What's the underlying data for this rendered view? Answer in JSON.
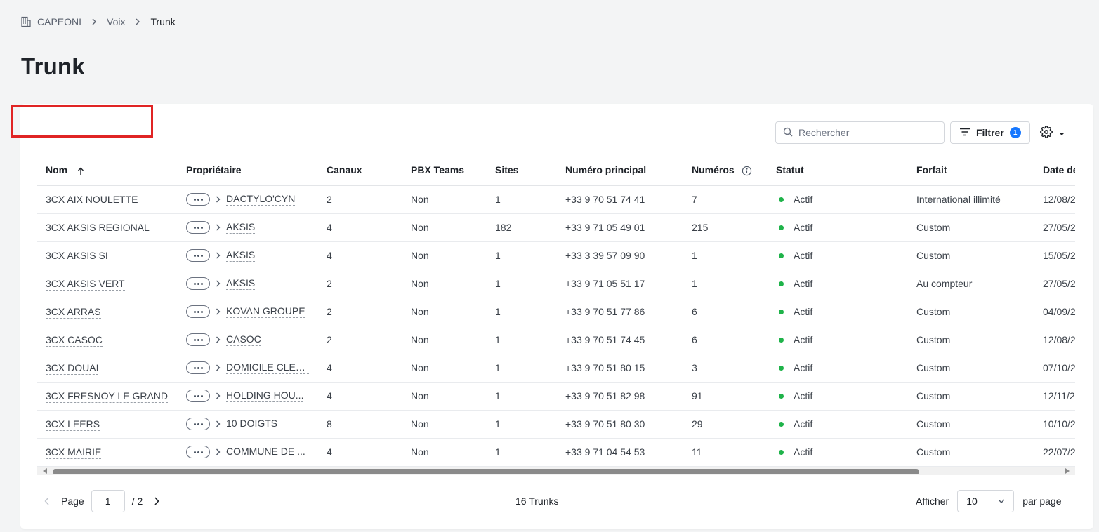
{
  "breadcrumb": {
    "org": "CAPEONI",
    "section": "Voix",
    "current": "Trunk"
  },
  "page_title": "Trunk",
  "search": {
    "placeholder": "Rechercher"
  },
  "filter": {
    "label": "Filtrer",
    "count": "1"
  },
  "columns": {
    "nom": "Nom",
    "proprietaire": "Propriétaire",
    "canaux": "Canaux",
    "pbx": "PBX Teams",
    "sites": "Sites",
    "numero": "Numéro principal",
    "numeros": "Numéros",
    "statut": "Statut",
    "forfait": "Forfait",
    "date": "Date de"
  },
  "rows": [
    {
      "nom": "3CX AIX NOULETTE",
      "owner": "DACTYLO'CYN",
      "canaux": "2",
      "pbx": "Non",
      "sites": "1",
      "numero": "+33 9 70 51 74 41",
      "numeros": "7",
      "statut": "Actif",
      "forfait": "International illimité",
      "date": "12/08/2"
    },
    {
      "nom": "3CX AKSIS REGIONAL",
      "owner": "AKSIS",
      "canaux": "4",
      "pbx": "Non",
      "sites": "182",
      "numero": "+33 9 71 05 49 01",
      "numeros": "215",
      "statut": "Actif",
      "forfait": "Custom",
      "date": "27/05/2"
    },
    {
      "nom": "3CX AKSIS SI",
      "owner": "AKSIS",
      "canaux": "4",
      "pbx": "Non",
      "sites": "1",
      "numero": "+33 3 39 57 09 90",
      "numeros": "1",
      "statut": "Actif",
      "forfait": "Custom",
      "date": "15/05/2"
    },
    {
      "nom": "3CX AKSIS VERT",
      "owner": "AKSIS",
      "canaux": "2",
      "pbx": "Non",
      "sites": "1",
      "numero": "+33 9 71 05 51 17",
      "numeros": "1",
      "statut": "Actif",
      "forfait": "Au compteur",
      "date": "27/05/2"
    },
    {
      "nom": "3CX ARRAS",
      "owner": "KOVAN GROUPE",
      "canaux": "2",
      "pbx": "Non",
      "sites": "1",
      "numero": "+33 9 70 51 77 86",
      "numeros": "6",
      "statut": "Actif",
      "forfait": "Custom",
      "date": "04/09/2"
    },
    {
      "nom": "3CX CASOC",
      "owner": "CASOC",
      "canaux": "2",
      "pbx": "Non",
      "sites": "1",
      "numero": "+33 9 70 51 74 45",
      "numeros": "6",
      "statut": "Actif",
      "forfait": "Custom",
      "date": "12/08/2"
    },
    {
      "nom": "3CX DOUAI",
      "owner": "DOMICILE CLEAN",
      "canaux": "4",
      "pbx": "Non",
      "sites": "1",
      "numero": "+33 9 70 51 80 15",
      "numeros": "3",
      "statut": "Actif",
      "forfait": "Custom",
      "date": "07/10/2"
    },
    {
      "nom": "3CX FRESNOY LE GRAND",
      "owner": "HOLDING HOU...",
      "canaux": "4",
      "pbx": "Non",
      "sites": "1",
      "numero": "+33 9 70 51 82 98",
      "numeros": "91",
      "statut": "Actif",
      "forfait": "Custom",
      "date": "12/11/20"
    },
    {
      "nom": "3CX LEERS",
      "owner": "10 DOIGTS",
      "canaux": "8",
      "pbx": "Non",
      "sites": "1",
      "numero": "+33 9 70 51 80 30",
      "numeros": "29",
      "statut": "Actif",
      "forfait": "Custom",
      "date": "10/10/2"
    },
    {
      "nom": "3CX MAIRIE",
      "owner": "COMMUNE DE ...",
      "canaux": "4",
      "pbx": "Non",
      "sites": "1",
      "numero": "+33 9 71 04 54 53",
      "numeros": "11",
      "statut": "Actif",
      "forfait": "Custom",
      "date": "22/07/2"
    }
  ],
  "pagination": {
    "page_label": "Page",
    "current": "1",
    "total": "/ 2"
  },
  "summary": "16 Trunks",
  "per_page": {
    "label": "Afficher",
    "value": "10",
    "suffix": "par page"
  },
  "colors": {
    "accent": "#1677ff",
    "status_active": "#1fb34a",
    "highlight": "#e02424"
  }
}
